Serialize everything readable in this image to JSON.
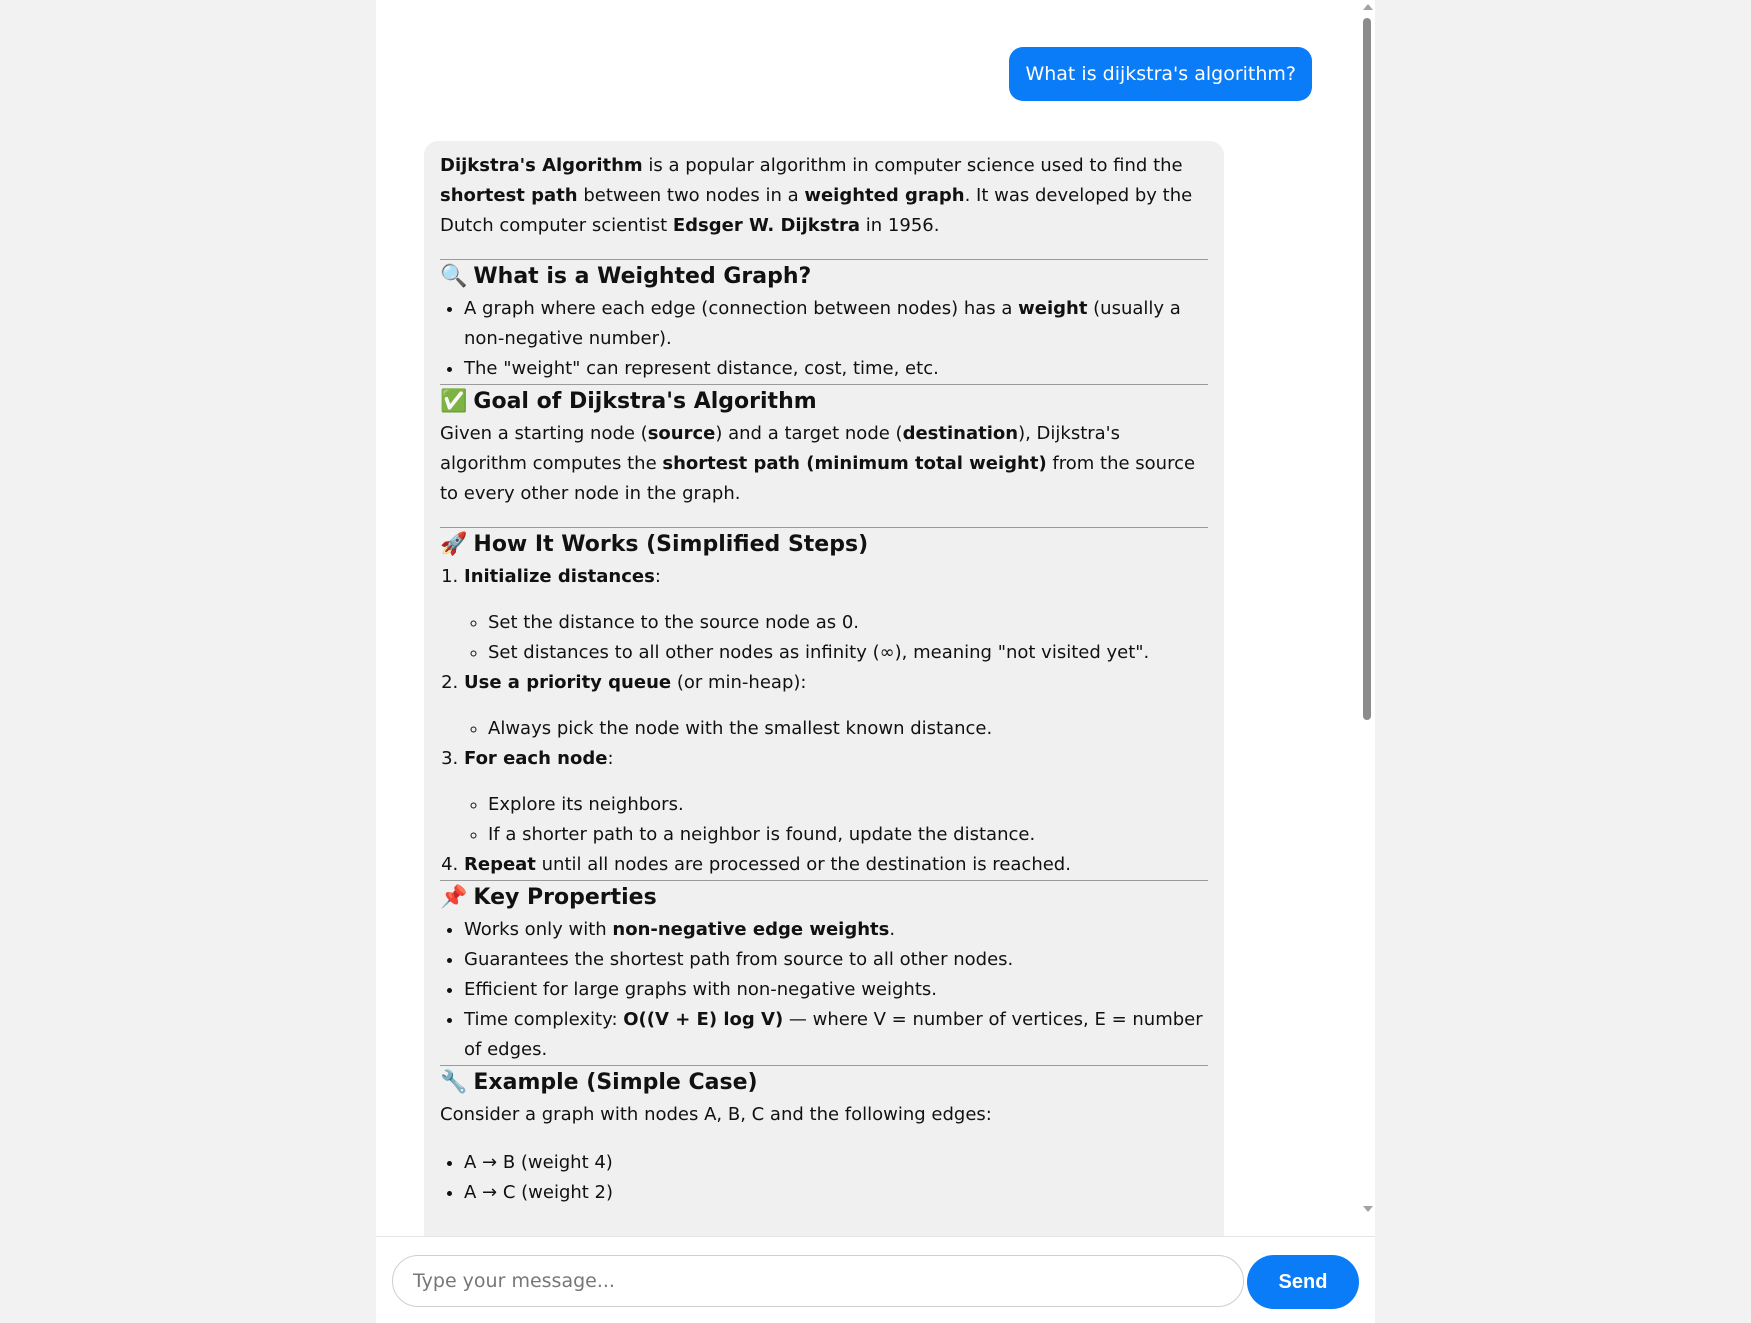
{
  "user_message": "What is dijkstra's algorithm?",
  "bot": {
    "intro": {
      "b1": "Dijkstra's Algorithm",
      "t1": " is a popular algorithm in computer science used to find the ",
      "b2": "shortest path",
      "t2": " between two nodes in a ",
      "b3": "weighted graph",
      "t3": ". It was developed by the Dutch computer scientist ",
      "b4": "Edsger W. Dijkstra",
      "t4": " in 1956."
    },
    "s1": {
      "emoji": "🔍",
      "title": "What is a Weighted Graph?",
      "li1": {
        "t1": "A graph where each edge (connection between nodes) has a ",
        "b1": "weight",
        "t2": " (usually a non-negative number)."
      },
      "li2": "The \"weight\" can represent distance, cost, time, etc."
    },
    "s2": {
      "emoji": "✅",
      "title": "Goal of Dijkstra's Algorithm",
      "t1": "Given a starting node (",
      "b1": "source",
      "t2": ") and a target node (",
      "b2": "destination",
      "t3": "), Dijkstra's algorithm computes the ",
      "b3": "shortest path (minimum total weight)",
      "t4": " from the source to every other node in the graph."
    },
    "s3": {
      "emoji": "🚀",
      "title": "How It Works (Simplified Steps)",
      "step1": {
        "b": "Initialize distances",
        "t": ":",
        "sub1": "Set the distance to the source node as 0.",
        "sub2": "Set distances to all other nodes as infinity (∞), meaning \"not visited yet\"."
      },
      "step2": {
        "b": "Use a priority queue",
        "t": " (or min-heap):",
        "sub1": "Always pick the node with the smallest known distance."
      },
      "step3": {
        "b": "For each node",
        "t": ":",
        "sub1": "Explore its neighbors.",
        "sub2": "If a shorter path to a neighbor is found, update the distance."
      },
      "step4": {
        "b": "Repeat",
        "t": " until all nodes are processed or the destination is reached."
      }
    },
    "s4": {
      "emoji": "📌",
      "title": "Key Properties",
      "li1": {
        "t1": "Works only with ",
        "b1": "non-negative edge weights",
        "t2": "."
      },
      "li2": "Guarantees the shortest path from source to all other nodes.",
      "li3": "Efficient for large graphs with non-negative weights.",
      "li4": {
        "t1": "Time complexity: ",
        "b1": "O((V + E) log V)",
        "t2": " — where V = number of vertices, E = number of edges."
      }
    },
    "s5": {
      "emoji": "🔧",
      "title": "Example (Simple Case)",
      "p": "Consider a graph with nodes A, B, C and the following edges:",
      "li1": "A → B (weight 4)",
      "li2": "A → C (weight 2)"
    }
  },
  "input": {
    "placeholder": "Type your message..."
  },
  "send_label": "Send"
}
